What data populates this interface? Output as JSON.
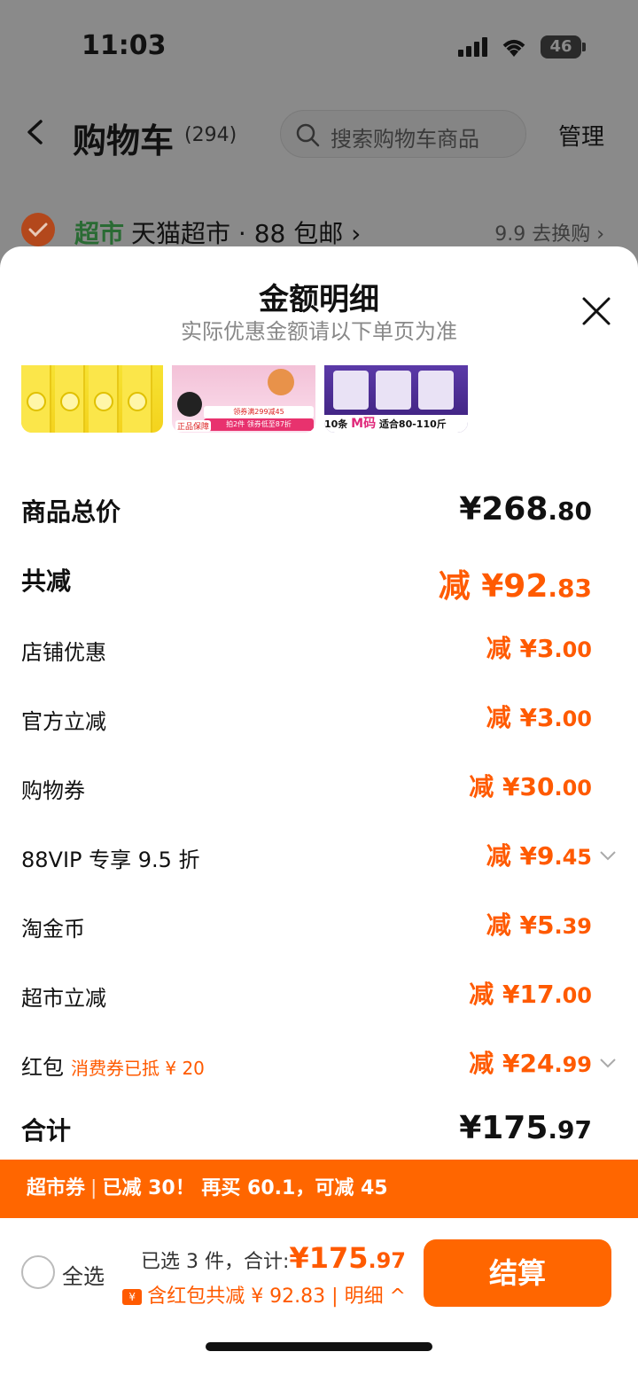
{
  "status": {
    "time": "11:03",
    "battery": "46"
  },
  "nav": {
    "title": "购物车",
    "count": "(294)",
    "search_placeholder": "搜索购物车商品",
    "manage": "管理"
  },
  "store": {
    "tag": "超市",
    "name": "天猫超市 · 88 包邮 ›",
    "right": "9.9 去换购 ›"
  },
  "sheet": {
    "title": "金额明细",
    "subtitle": "实际优惠金额请以下单页为准",
    "thumb2": {
      "badge": "正品保障",
      "line1": "领券满299减45",
      "line2": "拍2件 领券低至87折"
    },
    "thumb3": {
      "count": "10条",
      "size": "M码",
      "fit": "适合80-110斤"
    }
  },
  "rows": [
    {
      "label": "商品总价",
      "value": "¥268",
      "dec": ".80"
    },
    {
      "label": "共减",
      "value": "减 ¥92",
      "dec": ".83"
    },
    {
      "label": "店铺优惠",
      "value": "减 ¥3",
      "dec": ".00"
    },
    {
      "label": "官方立减",
      "value": "减 ¥3",
      "dec": ".00"
    },
    {
      "label": "购物券",
      "value": "减 ¥30",
      "dec": ".00"
    },
    {
      "label": "88VIP 专享 9.5 折",
      "value": "减 ¥9",
      "dec": ".45"
    },
    {
      "label": "淘金币",
      "value": "减 ¥5",
      "dec": ".39"
    },
    {
      "label": "超市立减",
      "value": "减 ¥17",
      "dec": ".00"
    },
    {
      "label": "红包",
      "note": "消费券已抵 ¥ 20",
      "value": "减 ¥24",
      "dec": ".99"
    },
    {
      "label": "合计",
      "value": "¥175",
      "dec": ".97"
    }
  ],
  "promo": {
    "label": "超市券",
    "text1": "已减 30！",
    "text2": "再买 60.1，可减 45"
  },
  "bottom": {
    "select_all": "全选",
    "selected_prefix": "已选 3 件，合计:",
    "total": "¥175",
    "total_dec": ".97",
    "detail_text": "含红包共减 ¥ 92.83 | 明细 ^",
    "detail_icon": "¥",
    "checkout": "结算"
  },
  "colors": {
    "accent": "#ff6600",
    "price": "#ff5a00"
  }
}
